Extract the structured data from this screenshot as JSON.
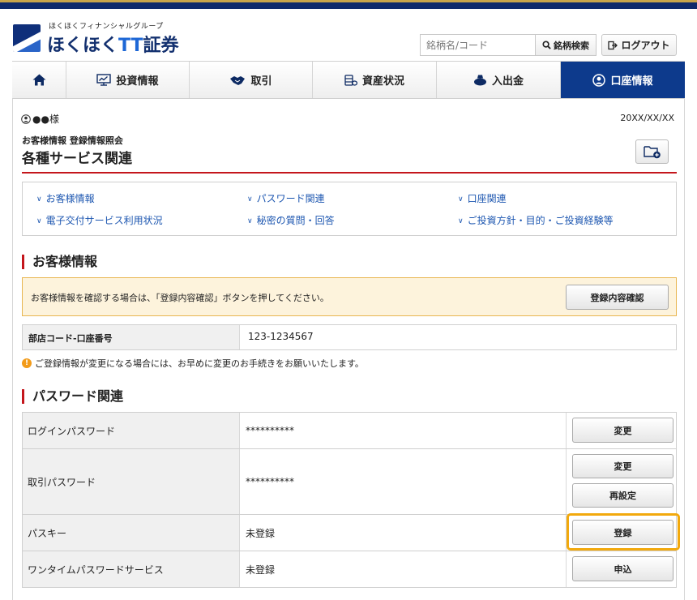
{
  "brand": {
    "group": "ほくほくフィナンシャルグループ",
    "name_prefix": "ほくほく",
    "name_tt": "TT",
    "name_suffix": "証券",
    "accent": "#0d3a8c",
    "highlight": "#f2a90d"
  },
  "header": {
    "search_placeholder": "銘柄名/コード",
    "search_button": "銘柄検索",
    "logout_button": "ログアウト"
  },
  "nav": {
    "home_icon": "home-icon",
    "items": [
      {
        "label": "投資情報",
        "icon": "monitor-chart-icon"
      },
      {
        "label": "取引",
        "icon": "handshake-icon"
      },
      {
        "label": "資産状況",
        "icon": "coins-icon"
      },
      {
        "label": "入出金",
        "icon": "money-bag-icon"
      },
      {
        "label": "口座情報",
        "icon": "user-circle-icon",
        "active": true
      }
    ]
  },
  "page": {
    "user": "●●様",
    "date": "20XX/XX/XX",
    "breadcrumb": "お客様情報 登録情報照会",
    "title": "各種サービス関連"
  },
  "links": [
    "お客様情報",
    "パスワード関連",
    "口座関連",
    "電子交付サービス利用状況",
    "秘密の質問・回答",
    "ご投資方針・目的・ご投資経験等"
  ],
  "customer": {
    "heading": "お客様情報",
    "notice": "お客様情報を確認する場合は、「登録内容確認」ボタンを押してください。",
    "confirm_button": "登録内容確認",
    "account_label": "部店コード-口座番号",
    "account_value": "123-1234567",
    "warning": "ご登録情報が変更になる場合には、お早めに変更のお手続きをお願いいたします。"
  },
  "password": {
    "heading": "パスワード関連",
    "rows": [
      {
        "label": "ログインパスワード",
        "value": "**********",
        "buttons": [
          "変更"
        ]
      },
      {
        "label": "取引パスワード",
        "value": "**********",
        "buttons": [
          "変更",
          "再設定"
        ]
      },
      {
        "label": "パスキー",
        "value": "未登録",
        "buttons": [
          "登録"
        ]
      },
      {
        "label": "ワンタイムパスワードサービス",
        "value": "未登録",
        "buttons": [
          "申込"
        ]
      }
    ]
  }
}
